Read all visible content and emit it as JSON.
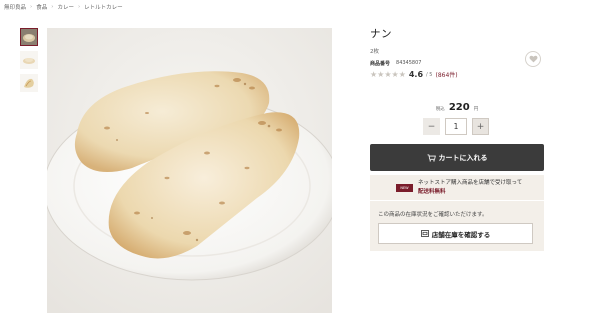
{
  "breadcrumb": [
    "無印良品",
    "食品",
    "カレー",
    "レトルトカレー"
  ],
  "product": {
    "title": "ナン",
    "quantity_text": "2枚",
    "code_label": "商品番号",
    "code_value": "84345807",
    "rating": {
      "value": "4.6",
      "max": "/ 5",
      "count": "(864件)",
      "stars_filled": 4.6
    }
  },
  "price": {
    "tax_label": "税込",
    "amount": "220",
    "unit": "円"
  },
  "quantity": {
    "minus": "−",
    "value": "1",
    "plus": "+"
  },
  "cart_button": {
    "label": "カートに入れる",
    "icon": "cart-icon"
  },
  "notice": {
    "badge": "NEW",
    "line1": "ネットストア購入商品を店舗で受け取って",
    "line2": "配送料無料"
  },
  "stock": {
    "text": "この商品の在庫状況をご確認いただけます。",
    "button_label": "店舗在庫を確認する",
    "icon": "store-icon"
  },
  "colors": {
    "accent": "#7a1d2b",
    "cart_bg": "#3b3b3b",
    "panel_bg": "#f3efe9"
  }
}
